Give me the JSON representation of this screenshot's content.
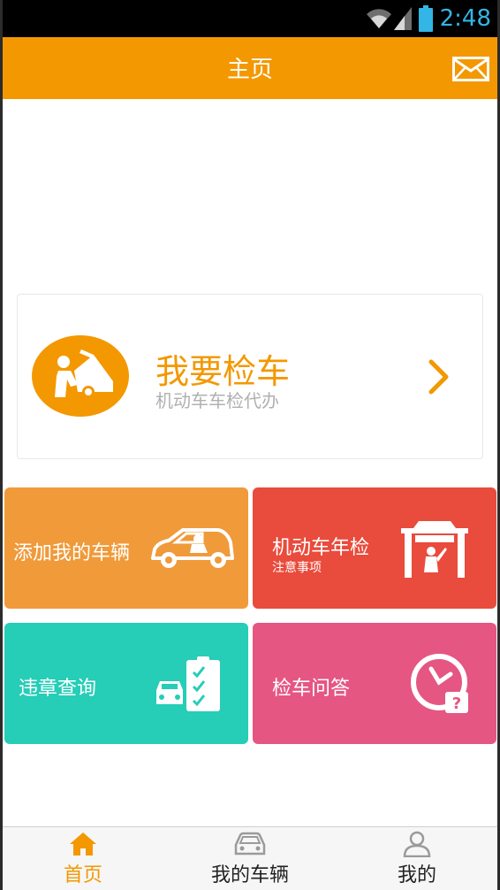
{
  "status_bar": {
    "time": "2:48",
    "accent_color": "#33b5e5"
  },
  "app_bar": {
    "title": "主页",
    "action_icon": "mail-icon",
    "color": "#f39800"
  },
  "check_card": {
    "title": "我要检车",
    "subtitle": "机动车车检代办",
    "icon": "mechanic-car-icon"
  },
  "tiles": [
    {
      "title": "添加我的车辆",
      "subtitle": "",
      "icon": "car-driver-icon",
      "color": "#f09a3a"
    },
    {
      "title": "机动车年检",
      "subtitle": "注意事项",
      "icon": "car-lift-icon",
      "color": "#e94b3c"
    },
    {
      "title": "违章查询",
      "subtitle": "",
      "icon": "checklist-car-icon",
      "color": "#26cdb7"
    },
    {
      "title": "检车问答",
      "subtitle": "",
      "icon": "clock-question-icon",
      "color": "#e55683"
    }
  ],
  "tab_bar": {
    "active_color": "#f39800",
    "items": [
      {
        "label": "首页",
        "icon": "home-icon",
        "active": true
      },
      {
        "label": "我的车辆",
        "icon": "car-icon",
        "active": false
      },
      {
        "label": "我的",
        "icon": "user-icon",
        "active": false
      }
    ]
  }
}
